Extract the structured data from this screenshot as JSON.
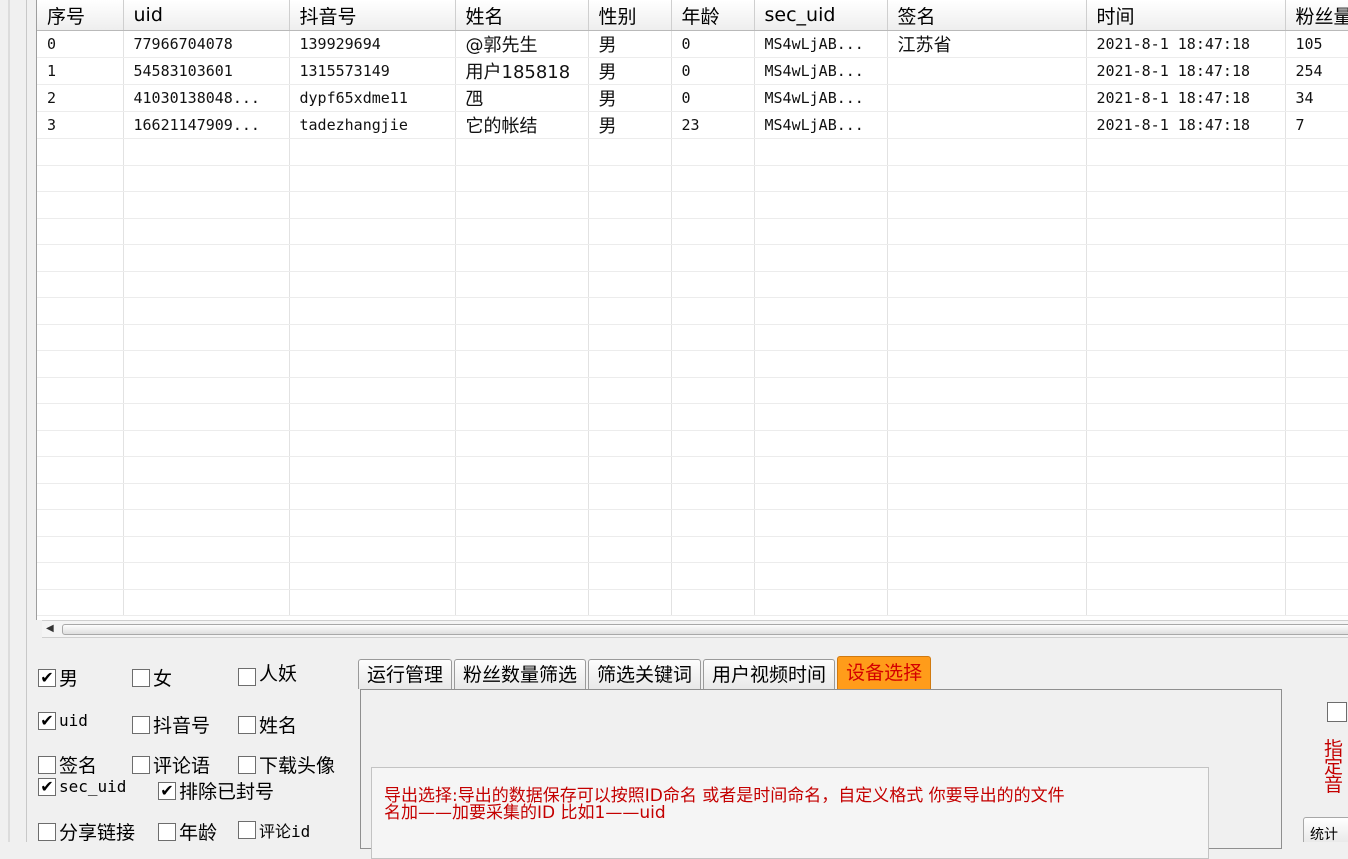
{
  "table": {
    "headers": [
      "序号",
      "uid",
      "抖音号",
      "姓名",
      "性别",
      "年龄",
      "sec_uid",
      "签名",
      "时间",
      "粉丝量"
    ],
    "rows": [
      [
        "0",
        "77966704078",
        "139929694",
        "@郭先生",
        "男",
        "0",
        "MS4wLjAB...",
        "江苏省",
        "2021-8-1 18:47:18",
        "105"
      ],
      [
        "1",
        "54583103601",
        "1315573149",
        "用户185818",
        "男",
        "0",
        "MS4wLjAB...",
        "",
        "2021-8-1 18:47:18",
        "254"
      ],
      [
        "2",
        "41030138048...",
        "dypf65xdme11",
        "乪",
        "男",
        "0",
        "MS4wLjAB...",
        "",
        "2021-8-1 18:47:18",
        "34"
      ],
      [
        "3",
        "16621147909...",
        "tadezhangjie",
        "它的帐结",
        "男",
        "23",
        "MS4wLjAB...",
        "",
        "2021-8-1 18:47:18",
        "7"
      ]
    ],
    "empty_rows": 18
  },
  "scrollbar": {
    "left_arrow": "◀"
  },
  "options": {
    "male": {
      "label": "男",
      "checked": true
    },
    "female": {
      "label": "女",
      "checked": false
    },
    "other": {
      "label": "人妖",
      "checked": false
    },
    "uid": {
      "label": "uid",
      "checked": true
    },
    "douyin_id": {
      "label": "抖音号",
      "checked": false
    },
    "name": {
      "label": "姓名",
      "checked": false
    },
    "signature": {
      "label": "签名",
      "checked": false
    },
    "comment_text": {
      "label": "评论语",
      "checked": false
    },
    "download_avatar": {
      "label": "下载头像",
      "checked": false
    },
    "sec_uid": {
      "label": "sec_uid",
      "checked": true
    },
    "exclude_banned": {
      "label": "排除已封号",
      "checked": true
    },
    "share_link": {
      "label": "分享链接",
      "checked": false
    },
    "age": {
      "label": "年龄",
      "checked": false
    },
    "comment_id": {
      "label": "评论id",
      "checked": false
    }
  },
  "tabs": [
    {
      "label": "运行管理",
      "active": false
    },
    {
      "label": "粉丝数量筛选",
      "active": false
    },
    {
      "label": "筛选关键词",
      "active": false
    },
    {
      "label": "用户视频时间",
      "active": false
    },
    {
      "label": "设备选择",
      "active": true
    }
  ],
  "panel": {
    "export_line1": "导出选择:导出的数据保存可以按照ID命名 或者是时间命名，自定义格式 你要导出的的文件",
    "export_line2": "名加——加要采集的ID   比如1——uid"
  },
  "right_panel": {
    "text": "指定音",
    "button_label": "统计"
  },
  "colors": {
    "active_tab_bg": "#ff9c1a",
    "active_tab_text": "#d40000",
    "hint_red": "#c40000"
  }
}
